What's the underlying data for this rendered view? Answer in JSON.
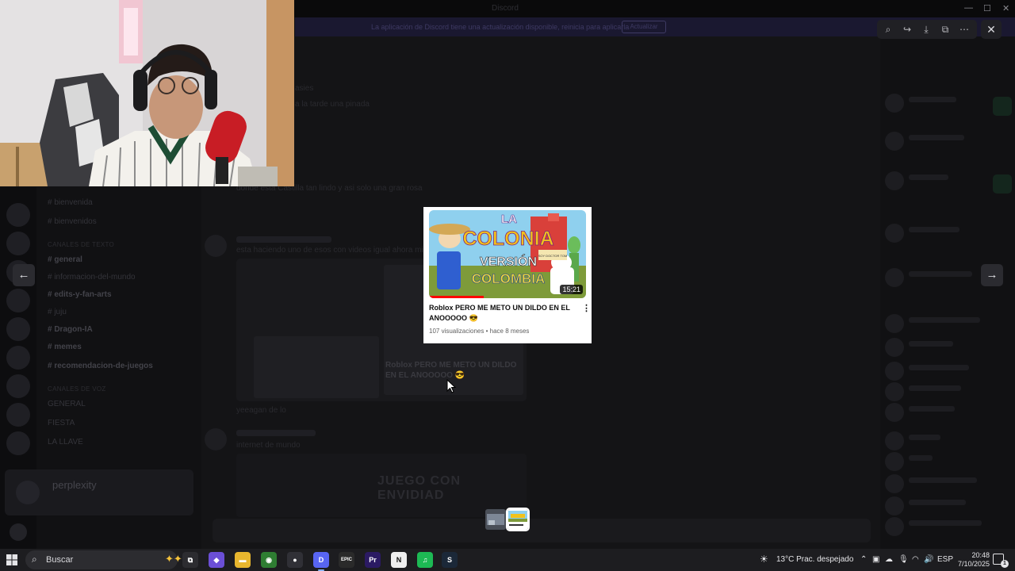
{
  "window": {
    "title": "Discord"
  },
  "banner": {
    "text": "La aplicación de Discord tiene una actualización disponible, reinicia para aplicarla",
    "button_label": "Actualizar"
  },
  "channels": {
    "rows": [
      {
        "label": "# bienvenida",
        "kind": "normal"
      },
      {
        "label": "# bienvenidos",
        "kind": "normal"
      },
      {
        "label": "CANALES DE TEXTO",
        "kind": "category"
      },
      {
        "label": "# general",
        "kind": "bold"
      },
      {
        "label": "# informacion-del-mundo",
        "kind": "normal"
      },
      {
        "label": "# edits-y-fan-arts",
        "kind": "bold"
      },
      {
        "label": "# juju",
        "kind": "normal"
      },
      {
        "label": "# Dragon-IA",
        "kind": "bold"
      },
      {
        "label": "# memes",
        "kind": "bold"
      },
      {
        "label": "# recomendacion-de-juegos",
        "kind": "bold"
      },
      {
        "label": "CANALES DE VOZ",
        "kind": "category"
      },
      {
        "label": "GENERAL",
        "kind": "normal"
      },
      {
        "label": "FIESTA",
        "kind": "normal"
      },
      {
        "label": "LA LLAVE",
        "kind": "normal"
      }
    ],
    "promo_title": "perplexity"
  },
  "chat": {
    "lines": [
      "asies",
      "a la tarde una pinada",
      "donde esta Castilla tan lindo y asi solo una gran rosa",
      "esta haciendo uno de esos con videos igual ahora mismo",
      "yeeagan de lo",
      "internet de mundo"
    ],
    "embed_caption": "Roblox PERO ME METO UN DILDO EN EL ANOOOOO 😎",
    "banner_text": "JUEGO CON ENVIDIAD"
  },
  "viewer": {
    "toolbar_icons": [
      "zoom-icon",
      "share-icon",
      "download-icon",
      "open-external-icon",
      "more-icon"
    ],
    "close_icon": "✕",
    "prev_icon": "←",
    "next_icon": "→"
  },
  "video": {
    "thumbnail_text": {
      "line1": "LA",
      "line2": "COLONIA",
      "line3": "VERSIÓN",
      "line4": "COLOMBIA",
      "sign": "SOY DOCTOR TOM"
    },
    "duration": "15:21",
    "progress_fraction": 0.35,
    "title": "Roblox PERO ME METO UN DILDO EN EL ANOOOOO 😎",
    "meta": "107 visualizaciones • hace 8 meses"
  },
  "taskbar": {
    "search_placeholder": "Buscar",
    "apps": [
      {
        "name": "task-view-icon",
        "label": "⧉",
        "color": "#2c2c30"
      },
      {
        "name": "copilot-icon",
        "label": "◆",
        "color": "#6b4fd6"
      },
      {
        "name": "file-explorer-icon",
        "label": "▬",
        "color": "#e8b62e"
      },
      {
        "name": "chrome-icon",
        "label": "◉",
        "color": "#2e7d32"
      },
      {
        "name": "obs-icon",
        "label": "●",
        "color": "#303036"
      },
      {
        "name": "discord-icon",
        "label": "D",
        "color": "#5865f2"
      },
      {
        "name": "epic-games-icon",
        "label": "EPIC",
        "color": "#2a2a2a"
      },
      {
        "name": "premiere-icon",
        "label": "Pr",
        "color": "#2b1a63"
      },
      {
        "name": "notion-icon",
        "label": "N",
        "color": "#efefef"
      },
      {
        "name": "spotify-icon",
        "label": "♫",
        "color": "#1db954"
      },
      {
        "name": "steam-icon",
        "label": "S",
        "color": "#1b2838"
      }
    ],
    "weather": "13°C  Prac. despejado",
    "language": "ESP",
    "time": "20:48",
    "date": "7/10/2025",
    "notification_count": "1"
  }
}
